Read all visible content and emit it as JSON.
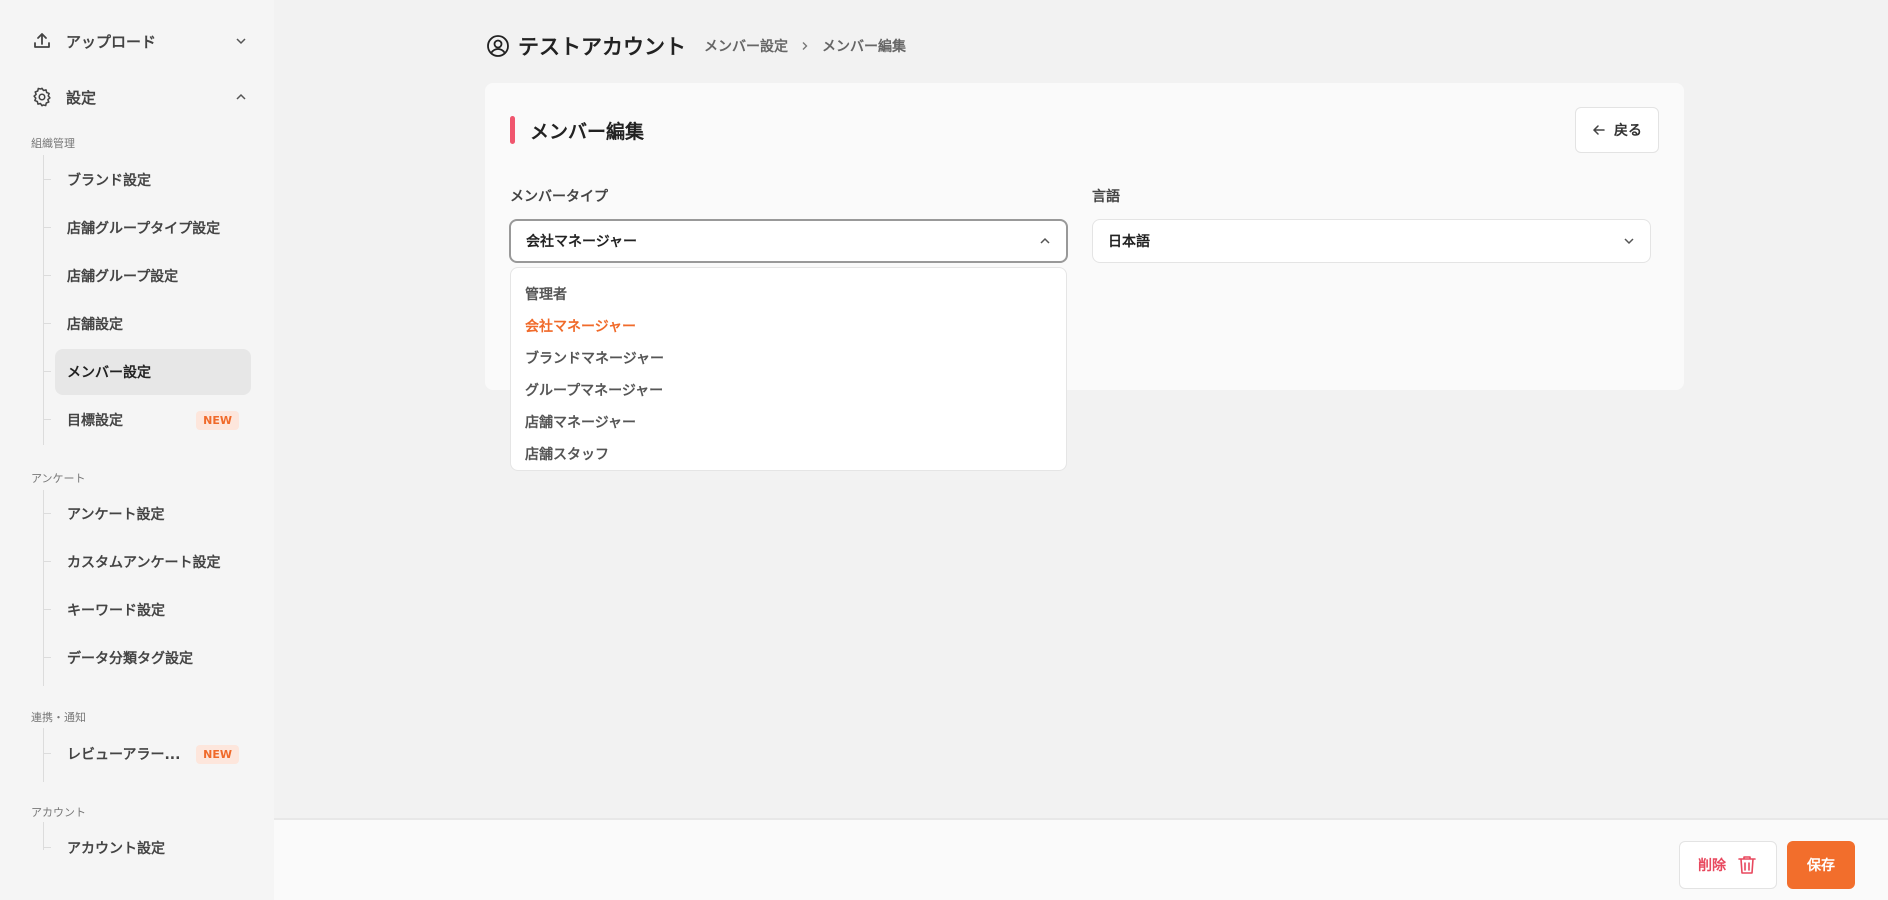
{
  "sidebar": {
    "upload": {
      "label": "アップロード",
      "icon": "upload-icon"
    },
    "settings": {
      "label": "設定",
      "icon": "gear-icon"
    },
    "sections": {
      "org": "組織管理",
      "survey": "アンケート",
      "integration": "連携・通知",
      "account": "アカウント"
    },
    "org_items": [
      "ブランド設定",
      "店舗グループタイプ設定",
      "店舗グループ設定",
      "店舗設定",
      "メンバー設定",
      "目標設定"
    ],
    "survey_items": [
      "アンケート設定",
      "カスタムアンケート設定",
      "キーワード設定",
      "データ分類タグ設定"
    ],
    "integration_items": [
      "レビューアラー..."
    ],
    "account_items": [
      "アカウント設定"
    ],
    "new_badge": "NEW"
  },
  "header": {
    "title": "テストアカウント",
    "breadcrumb": [
      "メンバー設定",
      "メンバー編集"
    ]
  },
  "card": {
    "title": "メンバー編集",
    "back_label": "戻る",
    "member_type": {
      "label": "メンバータイプ",
      "value": "会社マネージャー",
      "options": [
        "管理者",
        "会社マネージャー",
        "ブランドマネージャー",
        "グループマネージャー",
        "店舗マネージャー",
        "店舗スタッフ"
      ]
    },
    "language": {
      "label": "言語",
      "value": "日本語"
    }
  },
  "footer": {
    "delete_label": "削除",
    "save_label": "保存"
  },
  "colors": {
    "accent": "#f26e2c",
    "title_bar": "#f0566e",
    "delete": "#e8485e"
  }
}
